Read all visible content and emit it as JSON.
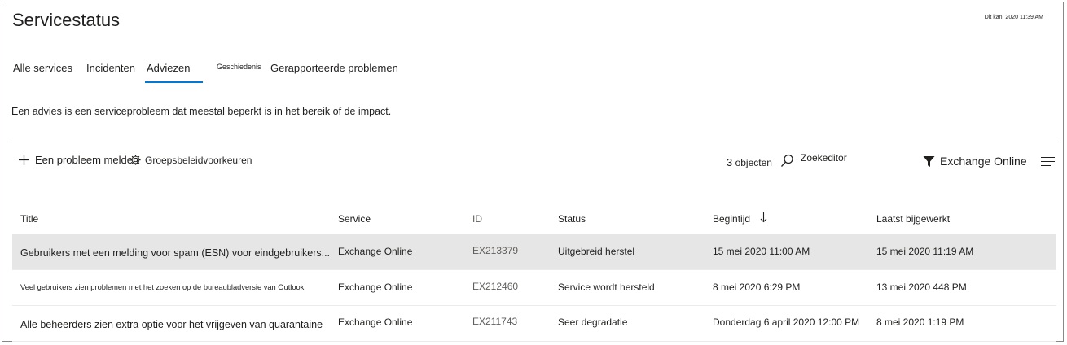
{
  "header": {
    "title": "Servicestatus",
    "timestamp": "Dit kan. 2020 11:39 AM"
  },
  "tabs": [
    {
      "label": "Alle services"
    },
    {
      "label": "Incidenten"
    },
    {
      "label": "Adviezen",
      "active": true
    },
    {
      "label": "Geschiedenis"
    },
    {
      "label": "Gerapporteerde problemen"
    }
  ],
  "info_text": "Een advies is een serviceprobleem dat meestal beperkt is in het bereik of de impact.",
  "toolbar": {
    "report_label": "Een probleem melden",
    "prefs_label": "Groepsbeleidvoorkeuren",
    "count_number": "3",
    "count_label": "objecten",
    "search_label": "Zoekeditor",
    "filter_label": "Exchange Online",
    "icons": [
      "plus-icon",
      "gear-icon",
      "search-icon",
      "filter-icon",
      "menu-icon"
    ]
  },
  "table": {
    "columns": [
      "Title",
      "Service",
      "ID",
      "Status",
      "Begintijd",
      "Laatst bijgewerkt"
    ],
    "rows": [
      [
        "Gebruikers met een melding voor spam (ESN) voor eindgebruikers...",
        "Exchange Online",
        "EX213379",
        "Uitgebreid herstel",
        "15 mei 2020 11:00 AM",
        "15 mei 2020 11:19 AM"
      ],
      [
        "Veel gebruikers zien problemen met het zoeken op de bureaubladversie van Outlook",
        "Exchange Online",
        "EX212460",
        "Service wordt hersteld",
        "8 mei 2020 6:29 PM",
        "13 mei 2020 448 PM"
      ],
      [
        "Alle beheerders zien extra optie voor het vrijgeven van quarantaine",
        "Exchange Online",
        "EX211743",
        "Seer degradatie",
        "Donderdag 6 april 2020 12:00 PM",
        "8 mei 2020 1:19 PM"
      ]
    ]
  },
  "colors": {
    "accent": "#0078d4",
    "selected_row": "#e6e6e6",
    "border": "#8a8886"
  }
}
